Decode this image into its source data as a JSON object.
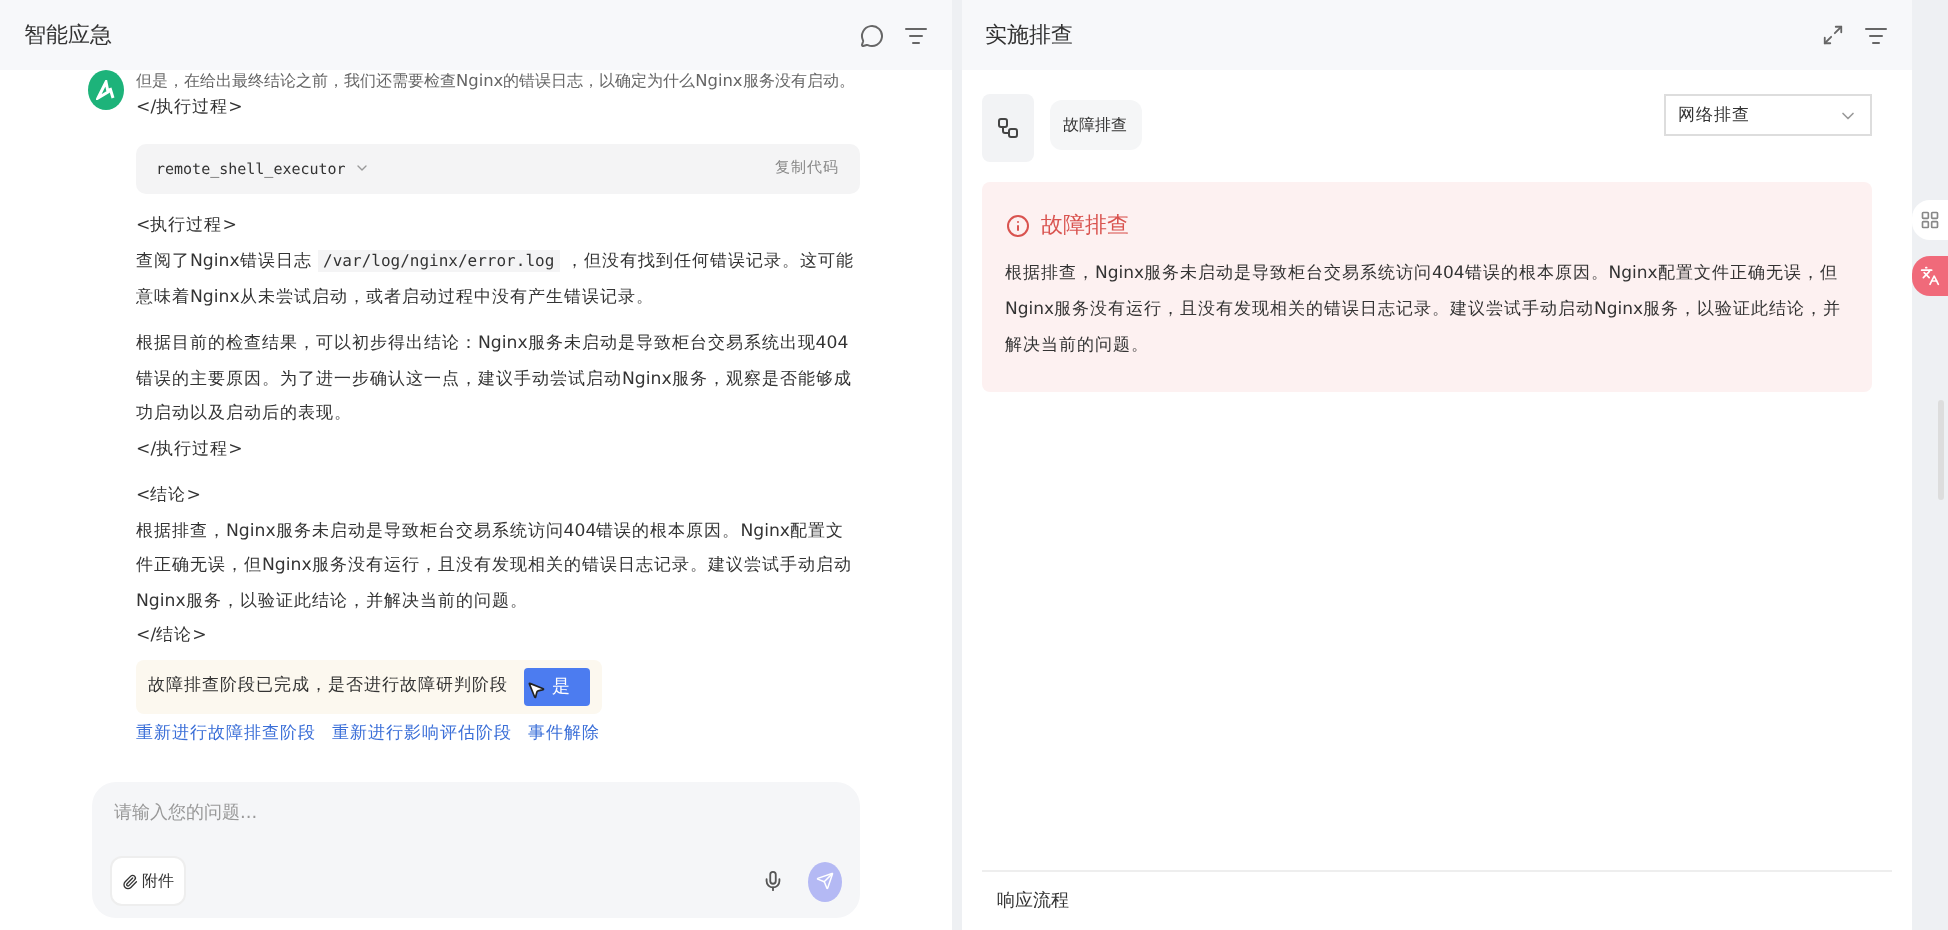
{
  "left_panel": {
    "title": "智能应急",
    "messages": [
      {
        "kind": "text",
        "text": "但是，在给出最终结论之前，我们还需要检查Nginx的错误日志，以确定为什么Nginx服务没有启动。"
      },
      {
        "kind": "text",
        "text": "</执行过程>"
      },
      {
        "kind": "tool",
        "name": "remote_shell_executor",
        "action": "复制代码",
        "expanded": false
      },
      {
        "kind": "text",
        "text": "<执行过程>"
      },
      {
        "kind": "rich",
        "before": "查阅了Nginx错误日志 ",
        "code": "/var/log/nginx/error.log",
        "after": " ，但没有找到任何错误记录。这可能意味着Nginx从未尝试启动，或者启动过程中没有产生错误记录。"
      },
      {
        "kind": "para",
        "text": "根据目前的检查结果，可以初步得出结论：Nginx服务未启动是导致柜台交易系统出现404错误的主要原因。为了进一步确认这一点，建议手动尝试启动Nginx服务，观察是否能够成功启动以及启动后的表现。"
      },
      {
        "kind": "text",
        "text": "</执行过程>"
      },
      {
        "kind": "gap",
        "text": "<结论>"
      },
      {
        "kind": "text",
        "text": "根据排查，Nginx服务未启动是导致柜台交易系统访问404错误的根本原因。Nginx配置文件正确无误，但Nginx服务没有运行，且没有发现相关的错误日志记录。建议尝试手动启动Nginx服务，以验证此结论，并解决当前的问题。"
      },
      {
        "kind": "text",
        "text": "</结论>"
      }
    ],
    "confirm": {
      "text": "故障排查阶段已完成，是否进行故障研判阶段",
      "button": "是"
    },
    "links": [
      "重新进行故障排查阶段",
      "重新进行影响评估阶段",
      "事件解除"
    ],
    "input": {
      "placeholder": "请输入您的问题...",
      "attach": "附件"
    }
  },
  "right_panel": {
    "title": "实施排查",
    "step": "故障排查",
    "dropdown": "网络排查",
    "alert": {
      "title": "故障排查",
      "text": "根据排查，Nginx服务未启动是导致柜台交易系统访问404错误的根本原因。Nginx配置文件正确无误，但Nginx服务没有运行，且没有发现相关的错误日志记录。建议尝试手动启动Nginx服务，以验证此结论，并解决当前的问题。"
    },
    "footer": "响应流程"
  }
}
